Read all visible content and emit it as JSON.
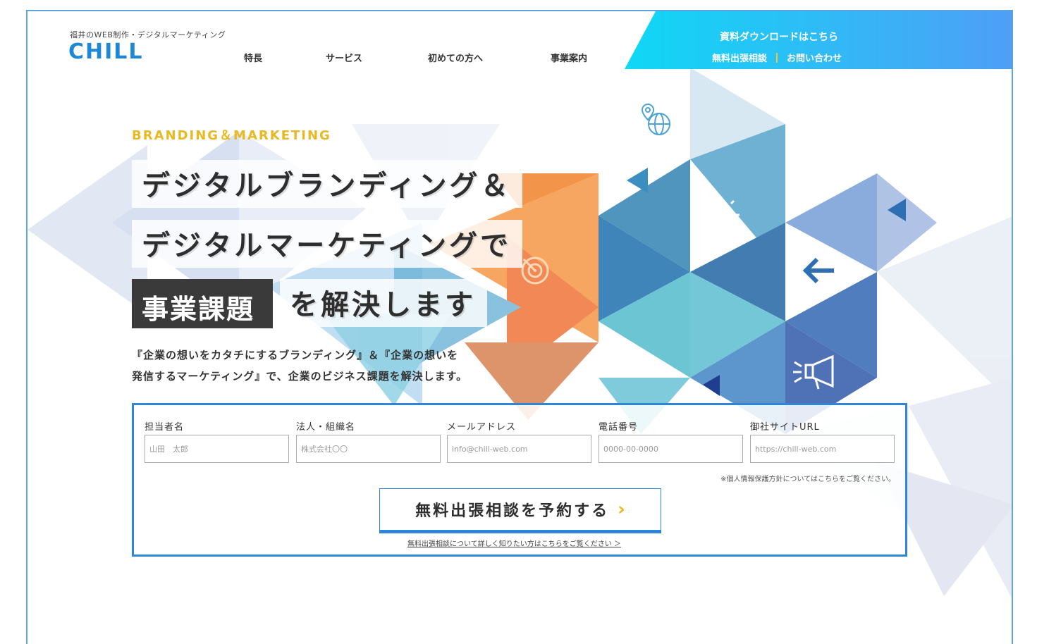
{
  "header": {
    "logo_sub": "福井のWEB制作・デジタルマーケティング",
    "logo": "CHILL",
    "nav": [
      "特長",
      "サービス",
      "初めての方へ",
      "事業案内"
    ],
    "cta_download": "資料ダウンロードはこちら",
    "cta_consult": "無料出張相談",
    "cta_contact": "お問い合わせ"
  },
  "hero": {
    "kicker": "BRANDING＆MARKETING",
    "line1": "デジタルブランディング＆",
    "line2": "デジタルマーケティングで",
    "line3_dark": "事業課題",
    "line3": "を解決します",
    "lead1": "『企業の想いをカタチにするブランディング』＆『企業の想いを",
    "lead2": "発信するマーケティング』で、企業のビジネス課題を解決します。"
  },
  "form": {
    "fields": [
      {
        "label": "担当者名",
        "placeholder": "山田　太郎"
      },
      {
        "label": "法人・組織名",
        "placeholder": "株式会社〇〇"
      },
      {
        "label": "メールアドレス",
        "placeholder": "info@chill-web.com"
      },
      {
        "label": "電話番号",
        "placeholder": "0000-00-0000"
      },
      {
        "label": "御社サイトURL",
        "placeholder": "https://chill-web.com"
      }
    ],
    "privacy_note": "※個人情報保護方針についてはこちらをご覧ください。",
    "submit_label": "無料出張相談を予約する",
    "more_link": "無料出張相談について詳しく知りたい方はこちらをご覧ください ＞"
  },
  "colors": {
    "brand_blue": "#1e87d6",
    "accent_yellow": "#e8b923",
    "border_blue": "#2f86d8"
  },
  "icons": [
    "map-globe-icon",
    "lightbulb-icon",
    "arrow-left-icon",
    "megaphone-icon",
    "target-icon"
  ]
}
